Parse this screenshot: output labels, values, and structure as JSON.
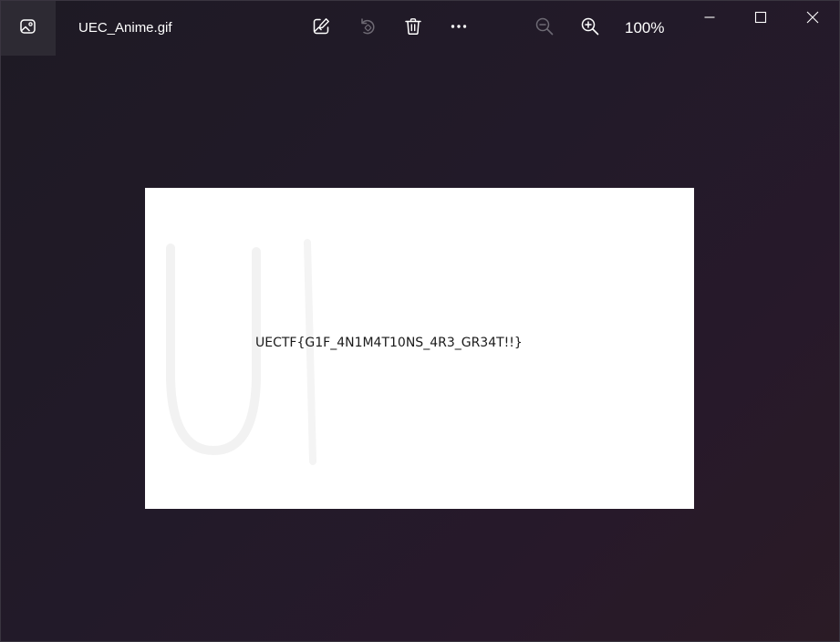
{
  "window": {
    "file_name": "UEC_Anime.gif"
  },
  "toolbar": {
    "zoom_level": "100%"
  },
  "image": {
    "content_text": "UECTF{G1F_4N1M4T10NS_4R3_GR34T!!}"
  },
  "icons": {
    "app": "photos-app-icon",
    "edit": "edit-image-icon",
    "rotate": "rotate-icon",
    "delete": "trash-icon",
    "more": "more-options-icon",
    "zoom_out": "zoom-out-icon",
    "zoom_in": "zoom-in-icon",
    "minimize": "minimize-icon",
    "maximize": "maximize-icon",
    "close": "close-icon"
  },
  "colors": {
    "background": "#221a29",
    "canvas": "#ffffff",
    "icon_enabled": "#ffffff",
    "icon_disabled": "#6e6a74"
  }
}
